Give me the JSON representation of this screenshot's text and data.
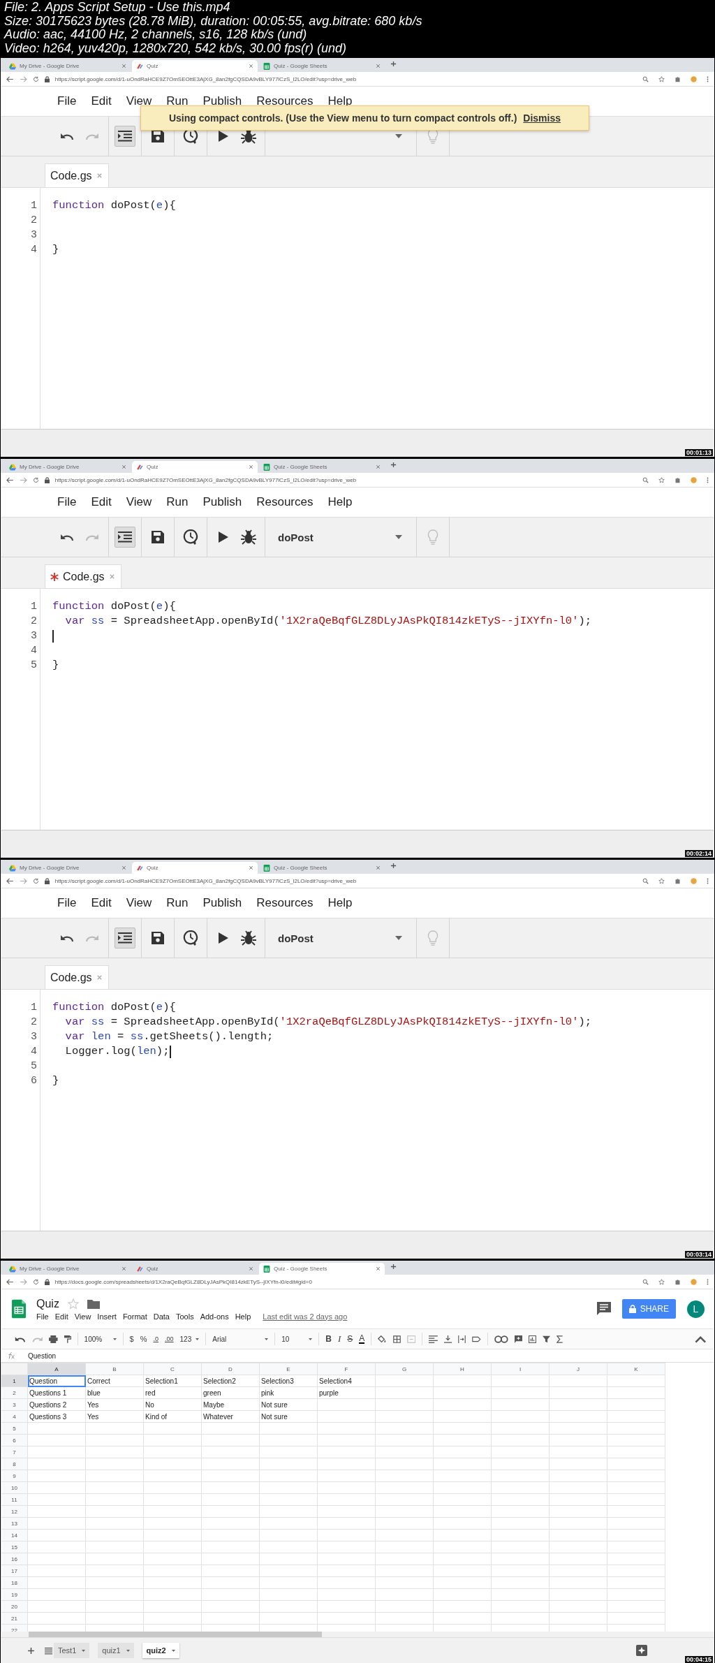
{
  "header": {
    "lines": [
      "File: 2. Apps Script Setup - Use this.mp4",
      "Size: 30175623 bytes (28.78 MiB), duration: 00:05:55, avg.bitrate: 680 kb/s",
      "Audio: aac, 44100 Hz, 2 channels, s16, 128 kb/s (und)",
      "Video: h264, yuv420p, 1280x720, 542 kb/s, 30.00 fps(r) (und)"
    ]
  },
  "frames": [
    {
      "kind": "script",
      "browser": {
        "tabs": [
          {
            "kind": "drive",
            "title": "My Drive - Google Drive",
            "selected": false
          },
          {
            "kind": "script",
            "title": "Quiz",
            "selected": true
          },
          {
            "kind": "sheets",
            "title": "Quiz - Google Sheets",
            "selected": false
          }
        ],
        "url": "https://script.google.com/d/1-uOndRaHCE9Z7OmSEOttE3AjXG_8an2fgCQSDA9vBLY977lCzS_l2LO/edit?usp=drive_web"
      },
      "menu": [
        "File",
        "Edit",
        "View",
        "Run",
        "Publish",
        "Resources",
        "Help"
      ],
      "notice": {
        "text": "Using compact controls. (Use the View menu to turn compact controls off.)",
        "action": "Dismiss"
      },
      "file_tab": {
        "label": "Code.gs",
        "modified": false
      },
      "code": [
        {
          "number": "1",
          "tokens": [
            {
              "kind": "keyword",
              "text": "function"
            },
            {
              "kind": "plain",
              "text": " doPost("
            },
            {
              "kind": "def",
              "text": "e"
            },
            {
              "kind": "plain",
              "text": "){"
            }
          ]
        },
        {
          "number": "2"
        },
        {
          "number": "3"
        },
        {
          "number": "4",
          "tokens": [
            {
              "kind": "plain",
              "text": "}"
            }
          ]
        }
      ],
      "timestamp": "00:01:13"
    },
    {
      "kind": "script",
      "browser": {
        "tabs": [
          {
            "kind": "drive",
            "title": "My Drive - Google Drive",
            "selected": false
          },
          {
            "kind": "script",
            "title": "Quiz",
            "selected": true
          },
          {
            "kind": "sheets",
            "title": "Quiz - Google Sheets",
            "selected": false
          }
        ],
        "url": "https://script.google.com/d/1-uOndRaHCE9Z7OmSEOttE3AjXG_8an2fgCQSDA9vBLY977lCzS_l2LO/edit?usp=drive_web"
      },
      "menu": [
        "File",
        "Edit",
        "View",
        "Run",
        "Publish",
        "Resources",
        "Help"
      ],
      "toolbar": {
        "function_name": "doPost"
      },
      "file_tab": {
        "label": "Code.gs",
        "modified": true
      },
      "code": [
        {
          "number": "1",
          "tokens": [
            {
              "kind": "keyword",
              "text": "function"
            },
            {
              "kind": "plain",
              "text": " doPost("
            },
            {
              "kind": "def",
              "text": "e"
            },
            {
              "kind": "plain",
              "text": "){"
            }
          ]
        },
        {
          "number": "2",
          "indent": true,
          "tokens": [
            {
              "kind": "keyword",
              "text": "var "
            },
            {
              "kind": "def",
              "text": "ss"
            },
            {
              "kind": "plain",
              "text": " = SpreadsheetApp.openById("
            },
            {
              "kind": "string",
              "text": "'1X2raQeBqfGLZ8DLyJAsPkQI814zkETyS--jIXYfn-l0'"
            },
            {
              "kind": "plain",
              "text": ");"
            }
          ]
        },
        {
          "number": "3",
          "cursor": true
        },
        {
          "number": "4"
        },
        {
          "number": "5",
          "tokens": [
            {
              "kind": "plain",
              "text": "}"
            }
          ]
        }
      ],
      "timestamp": "00:02:14"
    },
    {
      "kind": "script",
      "browser": {
        "tabs": [
          {
            "kind": "drive",
            "title": "My Drive - Google Drive",
            "selected": false
          },
          {
            "kind": "script",
            "title": "Quiz",
            "selected": true
          },
          {
            "kind": "sheets",
            "title": "Quiz - Google Sheets",
            "selected": false
          }
        ],
        "url": "https://script.google.com/d/1-uOndRaHCE9Z7OmSEOttE3AjXG_8an2fgCQSDA9vBLY977lCzS_l2LO/edit?usp=drive_web"
      },
      "menu": [
        "File",
        "Edit",
        "View",
        "Run",
        "Publish",
        "Resources",
        "Help"
      ],
      "toolbar": {
        "function_name": "doPost"
      },
      "file_tab": {
        "label": "Code.gs",
        "modified": false
      },
      "code": [
        {
          "number": "1",
          "tokens": [
            {
              "kind": "keyword",
              "text": "function"
            },
            {
              "kind": "plain",
              "text": " doPost("
            },
            {
              "kind": "def",
              "text": "e"
            },
            {
              "kind": "plain",
              "text": "){"
            }
          ]
        },
        {
          "number": "2",
          "indent": true,
          "tokens": [
            {
              "kind": "keyword",
              "text": "var "
            },
            {
              "kind": "def",
              "text": "ss"
            },
            {
              "kind": "plain",
              "text": " = SpreadsheetApp.openById("
            },
            {
              "kind": "string",
              "text": "'1X2raQeBqfGLZ8DLyJAsPkQI814zkETyS--jIXYfn-l0'"
            },
            {
              "kind": "plain",
              "text": ");"
            }
          ]
        },
        {
          "number": "3",
          "indent": true,
          "tokens": [
            {
              "kind": "keyword",
              "text": "var "
            },
            {
              "kind": "def",
              "text": "len"
            },
            {
              "kind": "plain",
              "text": " = "
            },
            {
              "kind": "def",
              "text": "ss"
            },
            {
              "kind": "plain",
              "text": ".getSheets().length;"
            }
          ]
        },
        {
          "number": "4",
          "indent": true,
          "cursor": true,
          "tokens": [
            {
              "kind": "plain",
              "text": "Logger.log("
            },
            {
              "kind": "def",
              "text": "len"
            },
            {
              "kind": "plain",
              "text": ");"
            }
          ]
        },
        {
          "number": "5"
        },
        {
          "number": "6",
          "tokens": [
            {
              "kind": "plain",
              "text": "}"
            }
          ]
        }
      ],
      "timestamp": "00:03:14"
    },
    {
      "kind": "sheets",
      "browser": {
        "tabs": [
          {
            "kind": "drive",
            "title": "My Drive - Google Drive",
            "selected": false
          },
          {
            "kind": "script",
            "title": "Quiz",
            "selected": false
          },
          {
            "kind": "sheets",
            "title": "Quiz - Google Sheets",
            "selected": true
          }
        ],
        "url": "https://docs.google.com/spreadsheets/d/1X2raQeBqfGLZ8DLyJAsPkQI814zkETyS--jIXYfn-l0/edit#gid=0"
      },
      "title": "Quiz",
      "menu": [
        "File",
        "Edit",
        "View",
        "Insert",
        "Format",
        "Data",
        "Tools",
        "Add-ons",
        "Help"
      ],
      "last_edit": "Last edit was 2 days ago",
      "share": "SHARE",
      "avatar": "L",
      "toolbar": {
        "zoom": "100%",
        "currency": "$",
        "percent": "%",
        "decimal_less": ".0",
        "decimal_more": ".00",
        "number_format": "123",
        "font": "Arial",
        "font_size": "10",
        "bold": "B",
        "italic": "I",
        "strike": "S",
        "text_color": "A"
      },
      "formula": "Question",
      "columns": [
        {
          "label": "A",
          "selected": true
        },
        {
          "label": "B",
          "selected": false
        },
        {
          "label": "C",
          "selected": false
        },
        {
          "label": "D",
          "selected": false
        },
        {
          "label": "E",
          "selected": false
        },
        {
          "label": "F",
          "selected": false
        },
        {
          "label": "G",
          "selected": false
        },
        {
          "label": "H",
          "selected": false
        },
        {
          "label": "I",
          "selected": false
        },
        {
          "label": "J",
          "selected": false
        },
        {
          "label": "K",
          "selected": false
        }
      ],
      "rows": [
        {
          "number": "1",
          "selected": true,
          "cells": [
            "Question",
            "Correct",
            "Selection1",
            "Selection2",
            "Selection3",
            "Selection4"
          ]
        },
        {
          "number": "2",
          "selected": false,
          "cells": [
            "Questions 1",
            "blue",
            "red",
            "green",
            "pink",
            "purple"
          ]
        },
        {
          "number": "3",
          "selected": false,
          "cells": [
            "Questions 2",
            "Yes",
            "No",
            "Maybe",
            "Not sure"
          ]
        },
        {
          "number": "4",
          "selected": false,
          "cells": [
            "Questions 3",
            "Yes",
            "Kind of",
            "Whatever",
            "Not sure"
          ]
        },
        {
          "number": "5",
          "selected": false
        },
        {
          "number": "6",
          "selected": false
        },
        {
          "number": "7",
          "selected": false
        },
        {
          "number": "8",
          "selected": false
        },
        {
          "number": "9",
          "selected": false
        },
        {
          "number": "10",
          "selected": false
        },
        {
          "number": "11",
          "selected": false
        },
        {
          "number": "12",
          "selected": false
        },
        {
          "number": "13",
          "selected": false
        },
        {
          "number": "14",
          "selected": false
        },
        {
          "number": "15",
          "selected": false
        },
        {
          "number": "16",
          "selected": false
        },
        {
          "number": "17",
          "selected": false
        },
        {
          "number": "18",
          "selected": false
        },
        {
          "number": "19",
          "selected": false
        },
        {
          "number": "20",
          "selected": false
        },
        {
          "number": "21",
          "selected": false
        },
        {
          "number": "22",
          "selected": false
        }
      ],
      "sheet_tabs": [
        {
          "label": "Test1",
          "selected": false
        },
        {
          "label": "quiz1",
          "selected": false
        },
        {
          "label": "quiz2",
          "selected": true
        }
      ],
      "timestamp": "00:04:15"
    }
  ]
}
